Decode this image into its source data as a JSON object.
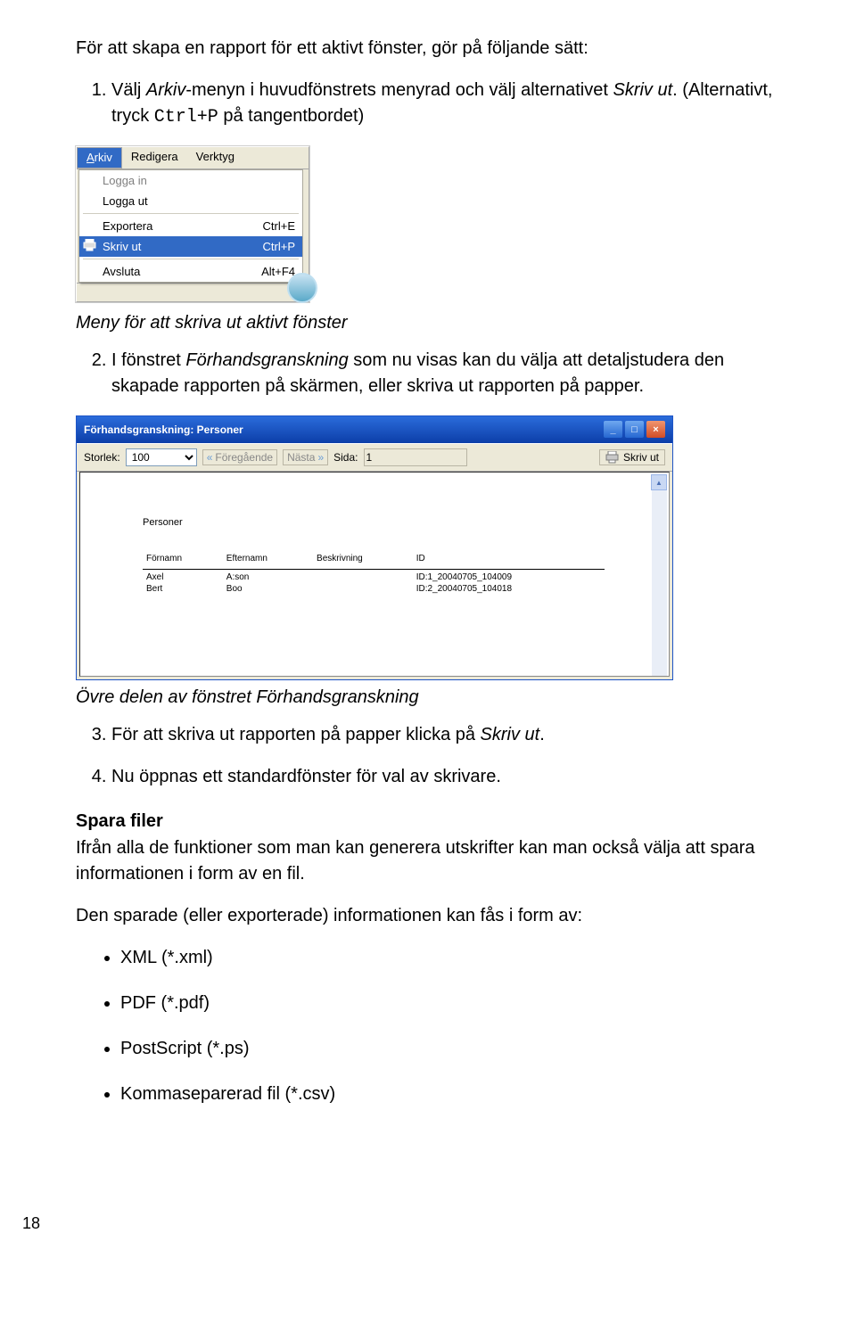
{
  "text": {
    "intro_line": "För att skapa en rapport för ett aktivt fönster, gör på följande sätt:",
    "step1_a": "Välj ",
    "step1_b": "Arkiv",
    "step1_c": "-menyn i huvudfönstrets menyrad och välj alternativet ",
    "step1_d": "Skriv ut",
    "step1_e": ". (Alternativt, tryck ",
    "step1_f": "Ctrl+P",
    "step1_g": " på tangentbordet)",
    "caption1": "Meny för att skriva ut aktivt fönster",
    "step2_a": "I fönstret ",
    "step2_b": "Förhandsgranskning",
    "step2_c": " som nu visas kan du välja att detaljstudera den skapade rapporten på skärmen, eller skriva ut rapporten på papper.",
    "caption2": "Övre delen av fönstret Förhandsgranskning",
    "step3_a": "För att skriva ut rapporten på papper klicka på ",
    "step3_b": "Skriv ut",
    "step3_c": ".",
    "step4": "Nu öppnas ett standardfönster för val av skrivare.",
    "spara_h": "Spara filer",
    "spara_p": "Ifrån alla de funktioner som man kan generera utskrifter kan man också välja att spara informationen i form av en fil.",
    "spara_p2": "Den sparade (eller exporterade) informationen kan fås i form av:",
    "formats": [
      "XML (*.xml)",
      "PDF (*.pdf)",
      "PostScript (*.ps)",
      "Kommaseparerad fil (*.csv)"
    ],
    "page_number": "18"
  },
  "menu": {
    "menubar": {
      "arkiv": "Arkiv",
      "redigera": "Redigera",
      "verktyg": "Verktyg"
    },
    "items": {
      "logga_in": "Logga in",
      "logga_ut": "Logga ut",
      "exportera": "Exportera",
      "exportera_sc": "Ctrl+E",
      "skrivut": "Skriv ut",
      "skrivut_sc": "Ctrl+P",
      "avsluta": "Avsluta",
      "avsluta_sc": "Alt+F4"
    }
  },
  "preview": {
    "title": "Förhandsgranskning: Personer",
    "storlek_lbl": "Storlek:",
    "storlek_val": "100",
    "prev_lbl": "Föregående",
    "next_lbl": "Nästa",
    "sida_lbl": "Sida:",
    "sida_val": "1",
    "print_lbl": "Skriv ut",
    "report_title": "Personer",
    "columns": [
      "Förnamn",
      "Efternamn",
      "Beskrivning",
      "ID"
    ],
    "rows": [
      [
        "Axel",
        "A:son",
        "",
        "ID:1_20040705_104009"
      ],
      [
        "Bert",
        "Boo",
        "",
        "ID:2_20040705_104018"
      ]
    ]
  }
}
